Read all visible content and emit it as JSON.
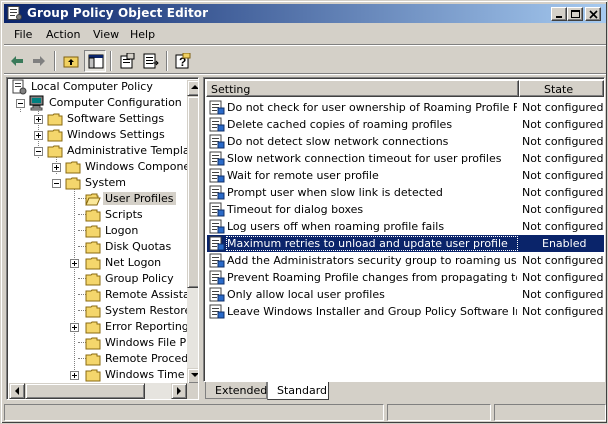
{
  "window": {
    "title": "Group Policy Object Editor",
    "colors": {
      "title_start": "#0a246a",
      "title_end": "#a6caf0",
      "selection": "#0a246a",
      "face": "#d4d0c8"
    }
  },
  "menu": [
    "File",
    "Action",
    "View",
    "Help"
  ],
  "toolbar": [
    "back-arrow-icon",
    "forward-arrow-icon",
    "up-folder-icon",
    "show-hide-tree-icon",
    "properties-icon",
    "export-list-icon",
    "help-icon"
  ],
  "tree": {
    "nodes": [
      {
        "label": "Local Computer Policy",
        "icon": "policy-icon"
      },
      {
        "label": "Computer Configuration",
        "icon": "computer-icon"
      },
      {
        "label": "Software Settings",
        "icon": "folder-icon"
      },
      {
        "label": "Windows Settings",
        "icon": "folder-icon"
      },
      {
        "label": "Administrative Templates",
        "icon": "folder-icon"
      },
      {
        "label": "Windows Components",
        "icon": "folder-icon"
      },
      {
        "label": "System",
        "icon": "folder-icon"
      },
      {
        "label": "User Profiles",
        "icon": "folder-open-icon",
        "selected": true
      },
      {
        "label": "Scripts",
        "icon": "folder-icon"
      },
      {
        "label": "Logon",
        "icon": "folder-icon"
      },
      {
        "label": "Disk Quotas",
        "icon": "folder-icon"
      },
      {
        "label": "Net Logon",
        "icon": "folder-icon"
      },
      {
        "label": "Group Policy",
        "icon": "folder-icon"
      },
      {
        "label": "Remote Assistance",
        "icon": "folder-icon"
      },
      {
        "label": "System Restore",
        "icon": "folder-icon"
      },
      {
        "label": "Error Reporting",
        "icon": "folder-icon"
      },
      {
        "label": "Windows File Protection",
        "icon": "folder-icon"
      },
      {
        "label": "Remote Procedure Call",
        "icon": "folder-icon"
      },
      {
        "label": "Windows Time Service",
        "icon": "folder-icon"
      }
    ]
  },
  "list": {
    "columns": [
      "Setting",
      "State"
    ],
    "rows": [
      {
        "setting": "Do not check for user ownership of Roaming Profile Folders",
        "state": "Not configured"
      },
      {
        "setting": "Delete cached copies of roaming profiles",
        "state": "Not configured"
      },
      {
        "setting": "Do not detect slow network connections",
        "state": "Not configured"
      },
      {
        "setting": "Slow network connection timeout for user profiles",
        "state": "Not configured"
      },
      {
        "setting": "Wait for remote user profile",
        "state": "Not configured"
      },
      {
        "setting": "Prompt user when slow link is detected",
        "state": "Not configured"
      },
      {
        "setting": "Timeout for dialog boxes",
        "state": "Not configured"
      },
      {
        "setting": "Log users off when roaming profile fails",
        "state": "Not configured"
      },
      {
        "setting": "Maximum retries to unload and update user profile",
        "state": "Enabled",
        "selected": true
      },
      {
        "setting": "Add the Administrators security group to roaming user pr...",
        "state": "Not configured"
      },
      {
        "setting": "Prevent Roaming Profile changes from propagating to the...",
        "state": "Not configured"
      },
      {
        "setting": "Only allow local user profiles",
        "state": "Not configured"
      },
      {
        "setting": "Leave Windows Installer and Group Policy Software Instal...",
        "state": "Not configured"
      }
    ]
  },
  "tabs": [
    {
      "label": "Extended",
      "active": false
    },
    {
      "label": "Standard",
      "active": true
    }
  ]
}
